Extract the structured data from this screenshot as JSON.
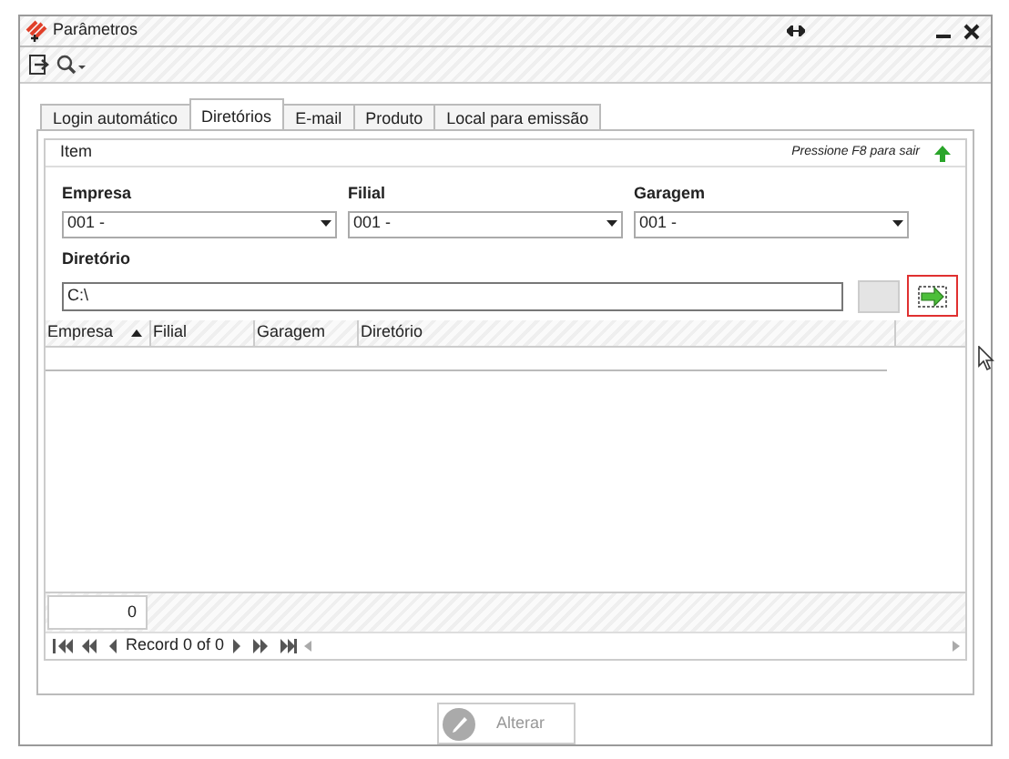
{
  "window": {
    "title": "Parâmetros"
  },
  "tabs": [
    {
      "label": "Login automático",
      "selected": false
    },
    {
      "label": "Diretórios",
      "selected": true
    },
    {
      "label": "E-mail",
      "selected": false
    },
    {
      "label": "Produto",
      "selected": false
    },
    {
      "label": "Local para emissão",
      "selected": false
    }
  ],
  "panel": {
    "header": "Item",
    "hint": "Pressione F8 para sair"
  },
  "fields": [
    {
      "label": "Empresa",
      "value": "001 -"
    },
    {
      "label": "Filial",
      "value": "001 -"
    },
    {
      "label": "Garagem",
      "value": "001 -"
    }
  ],
  "directory": {
    "label": "Diretório",
    "value": "C:\\"
  },
  "grid": {
    "columns": [
      {
        "label": "Empresa",
        "sorted": true
      },
      {
        "label": "Filial",
        "sorted": false
      },
      {
        "label": "Garagem",
        "sorted": false
      },
      {
        "label": "Diretório",
        "sorted": false
      }
    ],
    "summary": "0"
  },
  "navigator": {
    "text": "Record 0 of 0"
  },
  "buttons": [
    {
      "label": "Alterar",
      "disabled": true
    }
  ]
}
